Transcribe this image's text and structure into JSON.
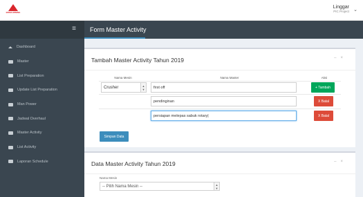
{
  "app": {
    "logo_text": "BOMA MINING",
    "user_name": "Linggar",
    "user_role": "PIC Project"
  },
  "sidebar": {
    "items": [
      {
        "label": "Dashboard",
        "icon": "home-icon"
      },
      {
        "label": "Master",
        "icon": "list-icon"
      },
      {
        "label": "List Preparation",
        "icon": "list-icon"
      },
      {
        "label": "Update List Preparation",
        "icon": "list-icon"
      },
      {
        "label": "Man Power",
        "icon": "list-icon"
      },
      {
        "label": "Jadwal Overhaul",
        "icon": "list-icon"
      },
      {
        "label": "Master Activity",
        "icon": "list-icon"
      },
      {
        "label": "List Activity",
        "icon": "list-icon"
      },
      {
        "label": "Laporan Schedule",
        "icon": "list-icon"
      }
    ]
  },
  "header": {
    "title": "Form Master Activity"
  },
  "panel_add": {
    "title": "Tambah Master Activity Tahun 2019",
    "col_machine": "Nama Mesin",
    "col_master": "Nama Master",
    "col_action": "Aksi",
    "machine_value": "Crusher",
    "rows": [
      {
        "value": "first off",
        "button": "+ Tambah"
      },
      {
        "value": "pendinginan",
        "button": "X Batal"
      },
      {
        "value": "persiapan melepas sabuk rotary|",
        "button": "X Batal"
      }
    ],
    "save_label": "Simpan Data"
  },
  "panel_data": {
    "title": "Data Master Activity Tahun 2019",
    "filter_label": "Nama Mesin",
    "filter_value": "-- Pilih Nama Mesin --"
  },
  "colors": {
    "accent": "#3c8dbc",
    "success": "#00a65a",
    "danger": "#dd4b39",
    "sidebar": "#3a4650"
  }
}
